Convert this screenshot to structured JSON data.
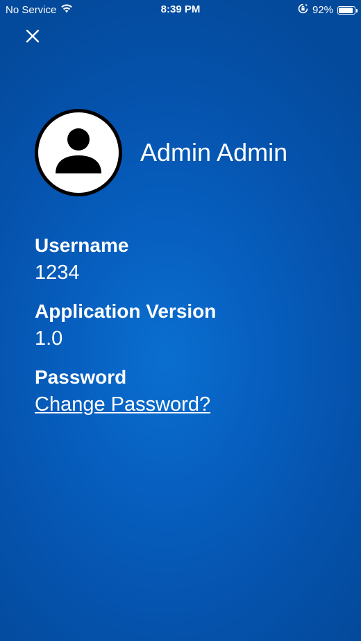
{
  "status_bar": {
    "carrier": "No Service",
    "time": "8:39 PM",
    "battery_percent_text": "92%",
    "battery_level": 0.92,
    "icons": [
      "wifi-icon",
      "orientation-lock-icon",
      "battery-icon"
    ]
  },
  "header": {
    "close_icon": "close-icon"
  },
  "profile": {
    "name": "Admin Admin",
    "avatar_icon": "person-icon"
  },
  "details": {
    "username_label": "Username",
    "username_value": "1234",
    "version_label": "Application Version",
    "version_value": "1.0",
    "password_label": "Password",
    "change_password_link": "Change Password?"
  },
  "colors": {
    "background": "#075fbf",
    "text": "#ffffff",
    "avatar_border": "#000000"
  }
}
